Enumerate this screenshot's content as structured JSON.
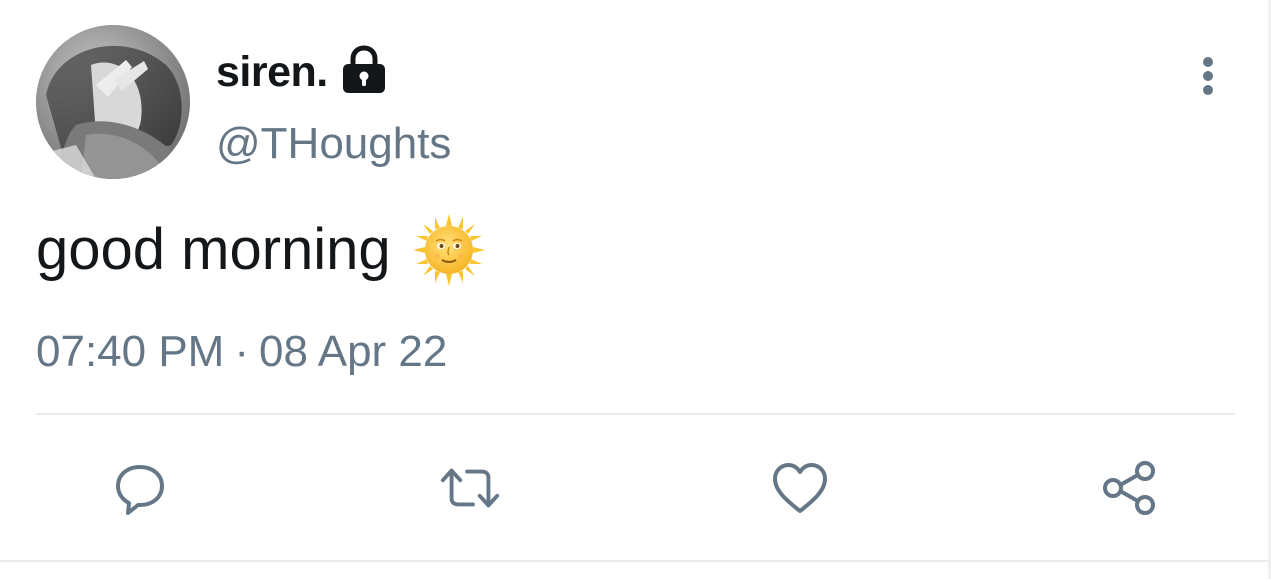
{
  "tweet": {
    "display_name": "siren.",
    "handle": "@THoughts",
    "text": "good morning",
    "emoji": "sun-with-face",
    "time": "07:40 PM",
    "separator": "·",
    "date": "08 Apr 22",
    "protected": true
  },
  "icons": {
    "lock": "lock-icon",
    "more": "more-vertical-icon",
    "reply": "reply-icon",
    "retweet": "retweet-icon",
    "like": "heart-icon",
    "share": "share-icon"
  },
  "colors": {
    "text_primary": "#14171a",
    "text_secondary": "#657786",
    "icon": "#657786",
    "divider": "#e6ecf0"
  }
}
